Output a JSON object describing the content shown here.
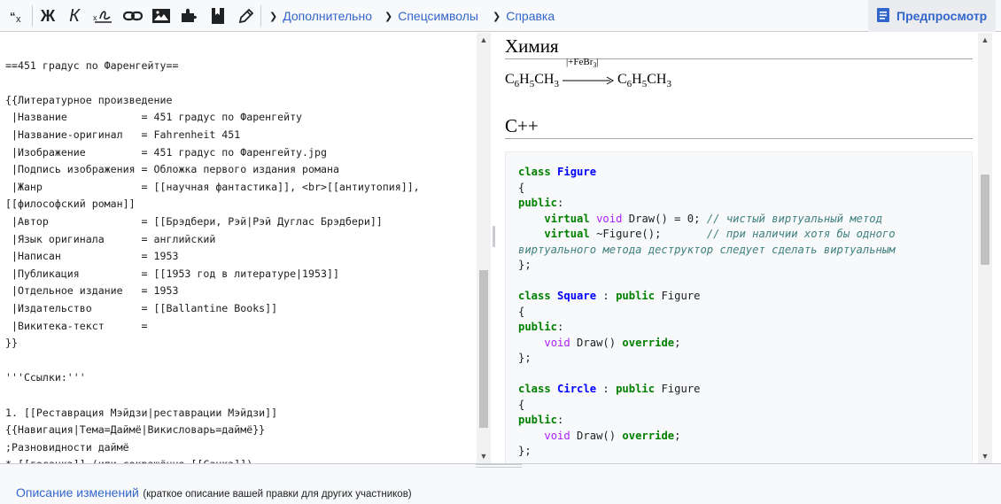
{
  "toolbar": {
    "buttons": [
      {
        "icon": "advanced-toggle-icon"
      },
      {
        "icon": "bold-icon",
        "glyph": "Ж"
      },
      {
        "icon": "italic-icon",
        "glyph": "К"
      },
      {
        "icon": "signature-icon"
      },
      {
        "icon": "link-icon"
      },
      {
        "icon": "image-icon"
      },
      {
        "icon": "puzzle-icon"
      },
      {
        "icon": "bookmark-icon"
      },
      {
        "icon": "pencil-icon"
      }
    ],
    "menus": [
      "Дополнительно",
      "Спецсимволы",
      "Справка"
    ],
    "preview_label": "Предпросмотр"
  },
  "editor": {
    "lines": [
      "",
      "==451 градус по Фаренгейту==",
      "",
      "{{Литературное произведение",
      " |Название            = 451 градус по Фаренгейту",
      " |Название-оригинал   = Fahrenheit 451",
      " |Изображение         = 451 градус по Фаренгейту.jpg",
      " |Подпись изображения = Обложка первого издания романа",
      " |Жанр                = [[научная фантастика]], <br>[[антиутопия]],",
      "[[философский роман]]",
      " |Автор               = [[Брэдбери, Рэй|Рэй Дуглас Брэдбери]]",
      " |Язык оригинала      = английский",
      " |Написан             = 1953",
      " |Публикация          = [[1953 год в литературе|1953]]",
      " |Отдельное издание   = 1953",
      " |Издательство        = [[Ballantine Books]]",
      " |Викитека-текст      =",
      "}}",
      "",
      "'''Ссылки:'''",
      "",
      "1. [[Реставрация Мэйдзи|реставрации Мэйдзи]]",
      "{{Навигация|Тема=Даймё|Викисловарь=даймё}}",
      ";Разновидности даймё",
      "* [[госанкэ]] (или сокращённо [[Санкэ]])"
    ]
  },
  "preview": {
    "heading_chem": "Химия",
    "formula": {
      "left": "C6H5CH3",
      "catalyst": "+FeBr3",
      "right": "C6H5CH3"
    },
    "heading_cpp": "C++",
    "code": [
      [
        [
          "kw",
          "class"
        ],
        [
          "pl",
          " "
        ],
        [
          "nm",
          "Figure"
        ]
      ],
      [
        [
          "pl",
          "{"
        ]
      ],
      [
        [
          "kw",
          "public"
        ],
        [
          "pl",
          ":"
        ]
      ],
      [
        [
          "pl",
          "    "
        ],
        [
          "kw",
          "virtual"
        ],
        [
          "pl",
          " "
        ],
        [
          "kwv",
          "void"
        ],
        [
          "pl",
          " Draw() = 0; "
        ],
        [
          "cm",
          "// чистый виртуальный метод"
        ]
      ],
      [
        [
          "pl",
          "    "
        ],
        [
          "kw",
          "virtual"
        ],
        [
          "pl",
          " ~Figure();       "
        ],
        [
          "cm",
          "// при наличии хотя бы одного"
        ]
      ],
      [
        [
          "cm",
          "виртуального метода деструктор следует сделать виртуальным"
        ]
      ],
      [
        [
          "pl",
          "};"
        ]
      ],
      [
        [
          "pl",
          ""
        ]
      ],
      [
        [
          "kw",
          "class"
        ],
        [
          "pl",
          " "
        ],
        [
          "nm",
          "Square"
        ],
        [
          "pl",
          " : "
        ],
        [
          "kw",
          "public"
        ],
        [
          "pl",
          " Figure"
        ]
      ],
      [
        [
          "pl",
          "{"
        ]
      ],
      [
        [
          "kw",
          "public"
        ],
        [
          "pl",
          ":"
        ]
      ],
      [
        [
          "pl",
          "    "
        ],
        [
          "kwv",
          "void"
        ],
        [
          "pl",
          " Draw() "
        ],
        [
          "kw",
          "override"
        ],
        [
          "pl",
          ";"
        ]
      ],
      [
        [
          "pl",
          "};"
        ]
      ],
      [
        [
          "pl",
          ""
        ]
      ],
      [
        [
          "kw",
          "class"
        ],
        [
          "pl",
          " "
        ],
        [
          "nm",
          "Circle"
        ],
        [
          "pl",
          " : "
        ],
        [
          "kw",
          "public"
        ],
        [
          "pl",
          " Figure"
        ]
      ],
      [
        [
          "pl",
          "{"
        ]
      ],
      [
        [
          "kw",
          "public"
        ],
        [
          "pl",
          ":"
        ]
      ],
      [
        [
          "pl",
          "    "
        ],
        [
          "kwv",
          "void"
        ],
        [
          "pl",
          " Draw() "
        ],
        [
          "kw",
          "override"
        ],
        [
          "pl",
          ";"
        ]
      ],
      [
        [
          "pl",
          "};"
        ]
      ]
    ]
  },
  "summary": {
    "label": "Описание изменений",
    "hint": "(краткое описание вашей правки для других участников)"
  },
  "colors": {
    "link": "#3366cc",
    "keyword": "#008000",
    "type": "#aa22ff",
    "name": "#0000ff",
    "comment": "#408080"
  }
}
